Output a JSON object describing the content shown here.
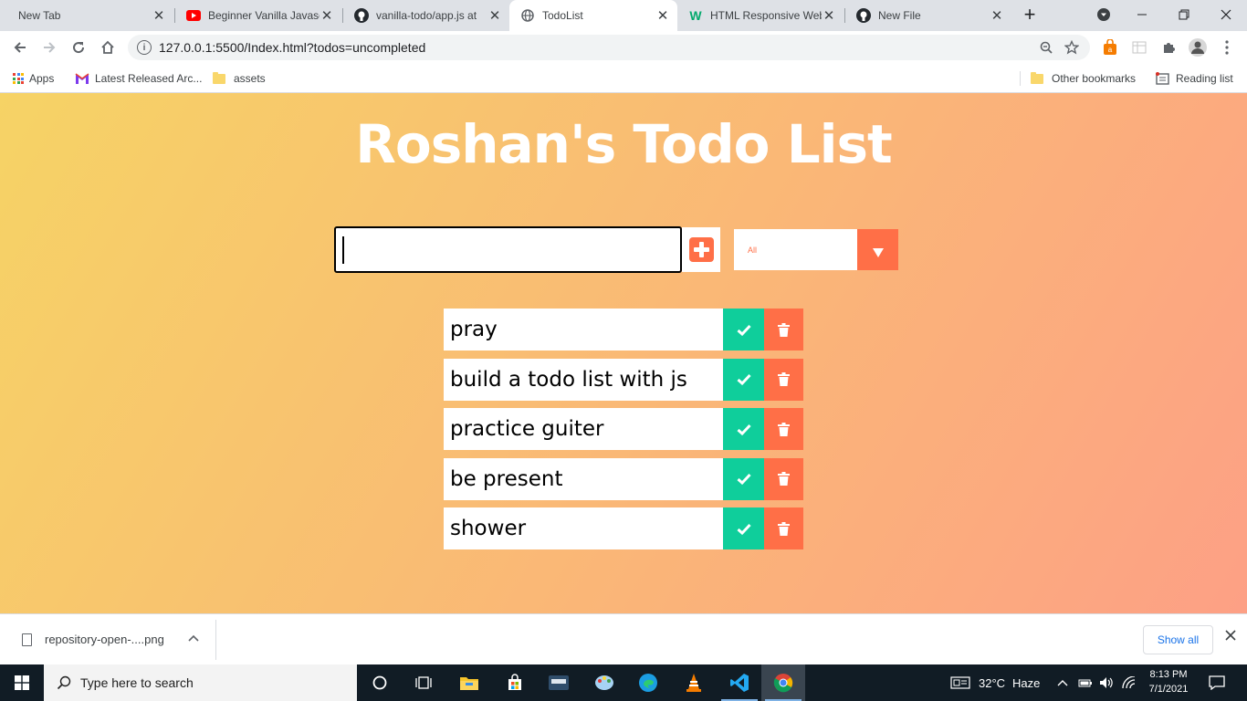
{
  "browser": {
    "tabs": [
      {
        "title": "New Tab",
        "active": false
      },
      {
        "title": "Beginner Vanilla Javasc",
        "active": false
      },
      {
        "title": "vanilla-todo/app.js at",
        "active": false
      },
      {
        "title": "TodoList",
        "active": true
      },
      {
        "title": "HTML Responsive Web",
        "active": false
      },
      {
        "title": "New File",
        "active": false
      }
    ],
    "new_tab_symbol": "+",
    "close_symbol": "✕",
    "url": "127.0.0.1:5500/Index.html?todos=uncompleted",
    "bookmarks": [
      {
        "label": "Apps",
        "icon": "apps-grid-icon"
      },
      {
        "label": "Latest Released Arc...",
        "icon": "gmail-icon"
      },
      {
        "label": "assets",
        "icon": "folder-icon"
      }
    ],
    "other_bookmarks": "Other bookmarks",
    "reading_list": "Reading list"
  },
  "app": {
    "title": "Roshan's Todo List",
    "input_value": "",
    "filter_selected": "All",
    "todos": [
      {
        "text": "pray"
      },
      {
        "text": "build a todo list with js"
      },
      {
        "text": "practice guiter"
      },
      {
        "text": "be present"
      },
      {
        "text": "shower"
      }
    ],
    "colors": {
      "gradient_start": "#f6d365",
      "gradient_end": "#fda085",
      "accent": "#ff6f47",
      "complete": "#0fce9b"
    }
  },
  "downloads": {
    "file_name": "repository-open-....png",
    "show_all": "Show all"
  },
  "taskbar": {
    "search_placeholder": "Type here to search",
    "weather_temp": "32°C",
    "weather_text": "Haze",
    "time": "8:13 PM",
    "date": "7/1/2021"
  }
}
